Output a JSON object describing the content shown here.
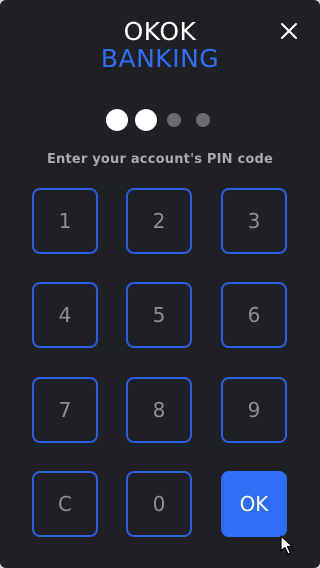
{
  "brand": {
    "line1": "OKOK",
    "line2": "BANKING"
  },
  "close": {
    "icon": "close-icon"
  },
  "pin": {
    "total_digits": 4,
    "entered_digits": 2,
    "label": "Enter your account's PIN code"
  },
  "keypad": {
    "keys": [
      "1",
      "2",
      "3",
      "4",
      "5",
      "6",
      "7",
      "8",
      "9",
      "C",
      "0",
      "OK"
    ]
  },
  "colors": {
    "background": "#1f2024",
    "accent": "#2f6ef5",
    "key_border": "#2b5fe0",
    "key_text": "#8e8f94",
    "label_text": "#a9a9ae"
  }
}
